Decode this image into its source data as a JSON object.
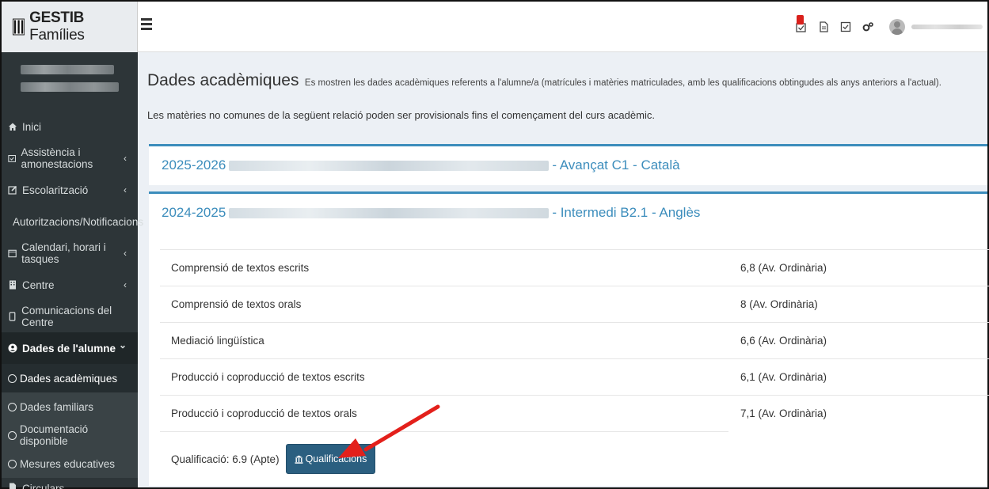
{
  "app": {
    "brand_bold": "GESTIB",
    "brand_rest": " Famílies"
  },
  "header": {
    "icons": [
      "notifications-icon",
      "document-icon",
      "check-square-icon",
      "settings-icon",
      "user-avatar-icon"
    ]
  },
  "sidebar": {
    "items": [
      {
        "label": "Inici",
        "icon": "home-icon"
      },
      {
        "label": "Assistència i amonestacions",
        "icon": "calendar-check-icon",
        "chevron": "‹"
      },
      {
        "label": "Escolarització",
        "icon": "edit-icon",
        "chevron": "‹"
      },
      {
        "label": "Autoritzacions/Notificacions",
        "icon": "check-square-icon"
      },
      {
        "label": "Calendari, horari i tasques",
        "icon": "calendar-icon",
        "chevron": "‹"
      },
      {
        "label": "Centre",
        "icon": "building-icon",
        "chevron": "‹"
      },
      {
        "label": "Comunicacions del Centre",
        "icon": "mobile-icon"
      },
      {
        "label": "Dades de l'alumne",
        "icon": "user-circle-icon",
        "chevron": "⌄"
      }
    ],
    "subitems": [
      {
        "label": "Dades acadèmiques"
      },
      {
        "label": "Dades familiars"
      },
      {
        "label": "Documentació disponible"
      },
      {
        "label": "Mesures educatives"
      }
    ],
    "cut_item": "Circulars"
  },
  "main": {
    "title": "Dades acadèmiques",
    "description": "Es mostren les dades acadèmiques referents a l'alumne/a (matrícules i matèries matriculades, amb les qualificacions obtingudes als anys anteriors a l'actual).",
    "note": "Les matèries no comunes de la següent relació poden ser provisionals fins el començament del curs acadèmic.",
    "panels": [
      {
        "year": "2025-2026",
        "suffix": "- Avançat C1 - Català"
      },
      {
        "year": "2024-2025",
        "suffix": "- Intermedi B2.1 - Anglès"
      }
    ],
    "grades": [
      {
        "subject": "Comprensió de textos escrits",
        "value": "6,8 (Av. Ordinària)"
      },
      {
        "subject": "Comprensió de textos orals",
        "value": "8 (Av. Ordinària)"
      },
      {
        "subject": "Mediació lingüística",
        "value": "6,6 (Av. Ordinària)"
      },
      {
        "subject": "Producció i coproducció de textos escrits",
        "value": "6,1 (Av. Ordinària)"
      },
      {
        "subject": "Producció i coproducció de textos orals",
        "value": "7,1 (Av. Ordinària)"
      }
    ],
    "final_label": "Qualificació: 6.9 (Apte)",
    "qual_button": "Qualificacions"
  },
  "colors": {
    "accent": "#3c8dbc",
    "sidebar": "#2d3538",
    "button": "#2b5f80",
    "arrow": "#e3201b"
  }
}
